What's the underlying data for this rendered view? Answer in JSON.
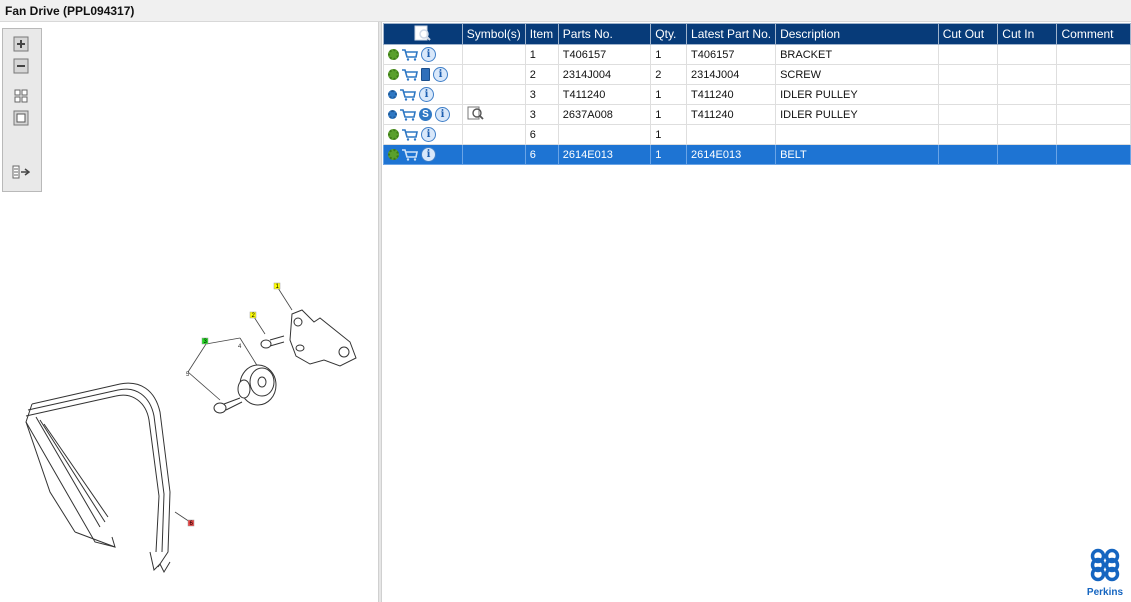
{
  "window": {
    "title": "Fan Drive (PPL094317)"
  },
  "viewer_toolbar": {
    "zoom_in_icon": "plus-icon",
    "zoom_out_icon": "minus-icon",
    "fit_all_icon": "grid-icon",
    "fit_window_icon": "square-icon",
    "panel_toggle_icon": "panel-arrow-icon"
  },
  "callouts": [
    "1",
    "2",
    "3",
    "4",
    "5",
    "6"
  ],
  "table": {
    "header_icon": "search-parts-icon",
    "columns": [
      "Symbol(s)",
      "Item",
      "Parts No.",
      "Qty.",
      "Latest Part No.",
      "Description",
      "Cut Out",
      "Cut In",
      "Comment"
    ],
    "rows": [
      {
        "item": "1",
        "parts_no": "T406157",
        "qty": "1",
        "latest": "T406157",
        "desc": "BRACKET",
        "cut_out": "",
        "cut_in": "",
        "comment": ""
      },
      {
        "item": "2",
        "parts_no": "2314J004",
        "qty": "2",
        "latest": "2314J004",
        "desc": "SCREW",
        "cut_out": "",
        "cut_in": "",
        "comment": ""
      },
      {
        "item": "3",
        "parts_no": "T411240",
        "qty": "1",
        "latest": "T411240",
        "desc": "IDLER PULLEY",
        "cut_out": "",
        "cut_in": "",
        "comment": ""
      },
      {
        "item": "3",
        "parts_no": "2637A008",
        "qty": "1",
        "latest": "T411240",
        "desc": "IDLER PULLEY",
        "cut_out": "",
        "cut_in": "",
        "comment": ""
      },
      {
        "item": "6",
        "parts_no": "",
        "qty": "1",
        "latest": "",
        "desc": "",
        "cut_out": "",
        "cut_in": "",
        "comment": ""
      },
      {
        "item": "6",
        "parts_no": "2614E013",
        "qty": "1",
        "latest": "2614E013",
        "desc": "BELT",
        "cut_out": "",
        "cut_in": "",
        "comment": ""
      }
    ],
    "selected_row": 5
  },
  "symbols": {
    "row3_symbol": "S"
  },
  "brand": {
    "name": "Perkins",
    "color": "#1565c0",
    "header_color": "#073b79",
    "selection_color": "#1e74d3"
  }
}
